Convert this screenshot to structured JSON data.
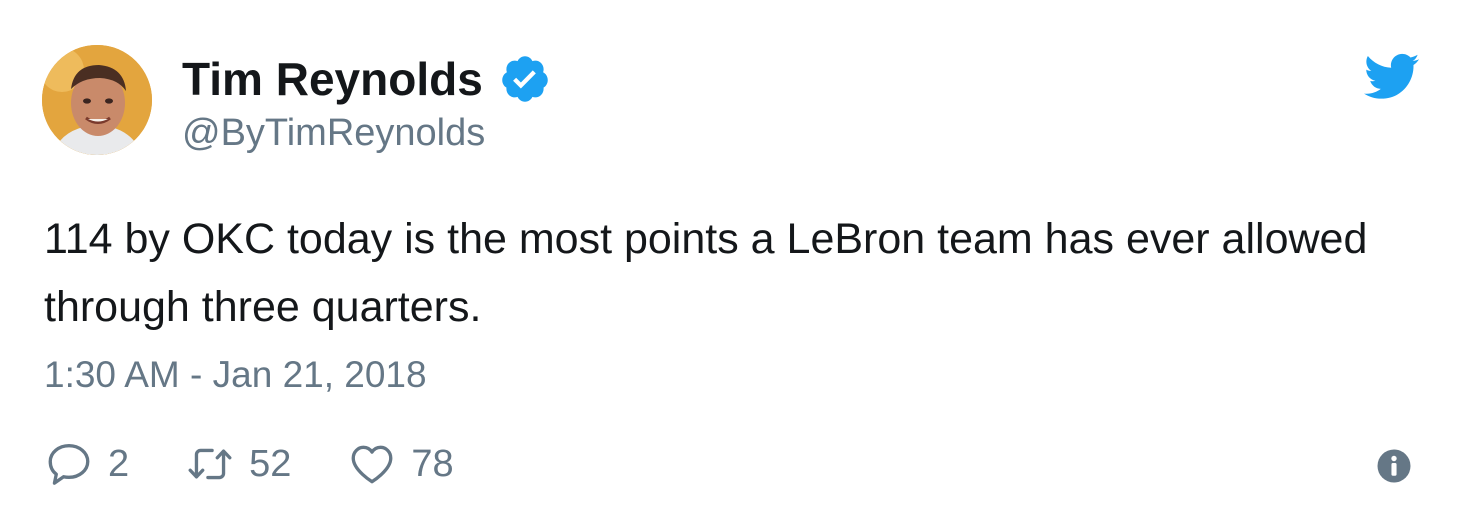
{
  "author": {
    "name": "Tim Reynolds",
    "handle": "@ByTimReynolds",
    "verified": true,
    "avatar_icon": "user-avatar"
  },
  "tweet": {
    "text": "114 by OKC today is the most points a LeBron team has ever allowed through three quarters.",
    "timestamp": "1:30 AM - Jan 21, 2018"
  },
  "actions": {
    "reply_count": "2",
    "retweet_count": "52",
    "like_count": "78"
  },
  "icons": {
    "brand": "twitter-bird-icon",
    "verified": "verified-badge-icon",
    "reply": "reply-icon",
    "retweet": "retweet-icon",
    "like": "heart-icon",
    "info": "info-icon"
  },
  "colors": {
    "brand": "#1da1f2",
    "text": "#14171a",
    "secondary": "#657786",
    "background": "#ffffff"
  }
}
